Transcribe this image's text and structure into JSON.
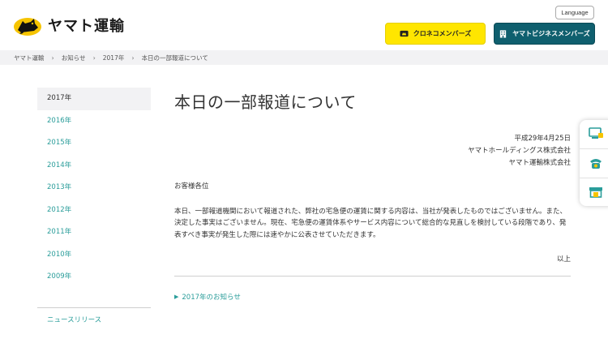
{
  "header": {
    "brand": "ヤマト運輸",
    "language_label": "Language",
    "kuroneko_member_label": "クロネコメンバーズ",
    "business_member_label": "ヤマトビジネスメンバーズ"
  },
  "breadcrumb": [
    "ヤマト運輸",
    "お知らせ",
    "2017年",
    "本日の一部報道について"
  ],
  "sidebar": {
    "years": [
      "2017年",
      "2016年",
      "2015年",
      "2014年",
      "2013年",
      "2012年",
      "2011年",
      "2010年",
      "2009年"
    ],
    "active_index": 0,
    "news_release_label": "ニュースリリース"
  },
  "article": {
    "title": "本日の一部報道について",
    "date": "平成29年4月25日",
    "issuer_1": "ヤマトホールディングス株式会社",
    "issuer_2": "ヤマト運輸株式会社",
    "salutation": "お客様各位",
    "body": "本日、一部報道機関において報道された、弊社の宅急便の運賃に関する内容は、当社が発表したものではございません。また、決定した事実はございません。現在、宅急便の運賃体系やサービス内容について総合的な見直しを検討している段階であり、発表すべき事実が発生した際には速やかに公表させていただきます。",
    "closing": "以上",
    "back_link": "2017年のお知らせ"
  },
  "float_icons": [
    "computer-icon",
    "phone-icon",
    "store-icon"
  ],
  "colors": {
    "teal_link": "#2a9d9a",
    "kuroneko_yellow": "#ffe600",
    "business_teal": "#0f5f6e",
    "breadcrumb_bg": "#f2f2f4"
  }
}
